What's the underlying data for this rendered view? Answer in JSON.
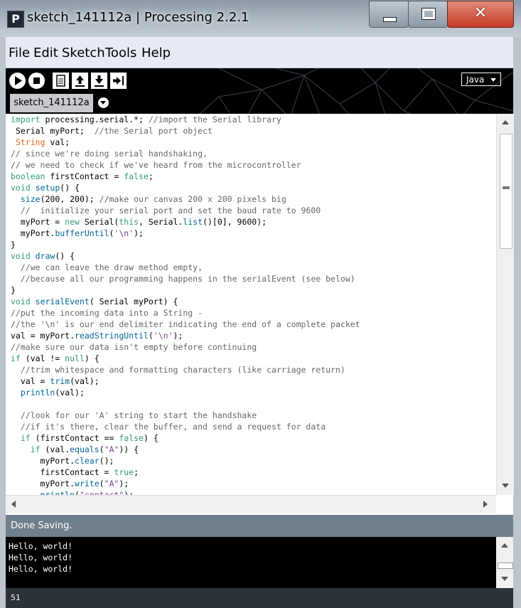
{
  "window": {
    "title": "sketch_141112a | Processing 2.2.1",
    "app_icon": "P"
  },
  "menu": [
    "File",
    "Edit",
    "Sketch",
    "Tools",
    "Help"
  ],
  "toolbar": {
    "mode": "Java"
  },
  "tab": {
    "name": "sketch_141112a"
  },
  "code_lines": [
    "import processing.serial.*; //import the Serial library",
    " Serial myPort;  //the Serial port object",
    " String val;",
    "// since we're doing serial handshaking,",
    "// we need to check if we've heard from the microcontroller",
    "boolean firstContact = false;",
    "void setup() {",
    "  size(200, 200); //make our canvas 200 x 200 pixels big",
    "  //  initialize your serial port and set the baud rate to 9600",
    "  myPort = new Serial(this, Serial.list()[0], 9600);",
    "  myPort.bufferUntil('\\n');",
    "}",
    "void draw() {",
    "  //we can leave the draw method empty,",
    "  //because all our programming happens in the serialEvent (see below)",
    "}",
    "void serialEvent( Serial myPort) {",
    "//put the incoming data into a String -",
    "//the '\\n' is our end delimiter indicating the end of a complete packet",
    "val = myPort.readStringUntil('\\n');",
    "//make sure our data isn't empty before continuing",
    "if (val != null) {",
    "  //trim whitespace and formatting characters (like carriage return)",
    "  val = trim(val);",
    "  println(val);",
    "",
    "  //look for our 'A' string to start the handshake",
    "  //if it's there, clear the buffer, and send a request for data",
    "  if (firstContact == false) {",
    "    if (val.equals(\"A\")) {",
    "      myPort.clear();",
    "      firstContact = true;",
    "      myPort.write(\"A\");",
    "      println(\"contact\");"
  ],
  "status": {
    "message": "Done Saving."
  },
  "console": {
    "lines": [
      "Hello, world!",
      "Hello, world!",
      "Hello, world!"
    ]
  },
  "line_number": "51"
}
